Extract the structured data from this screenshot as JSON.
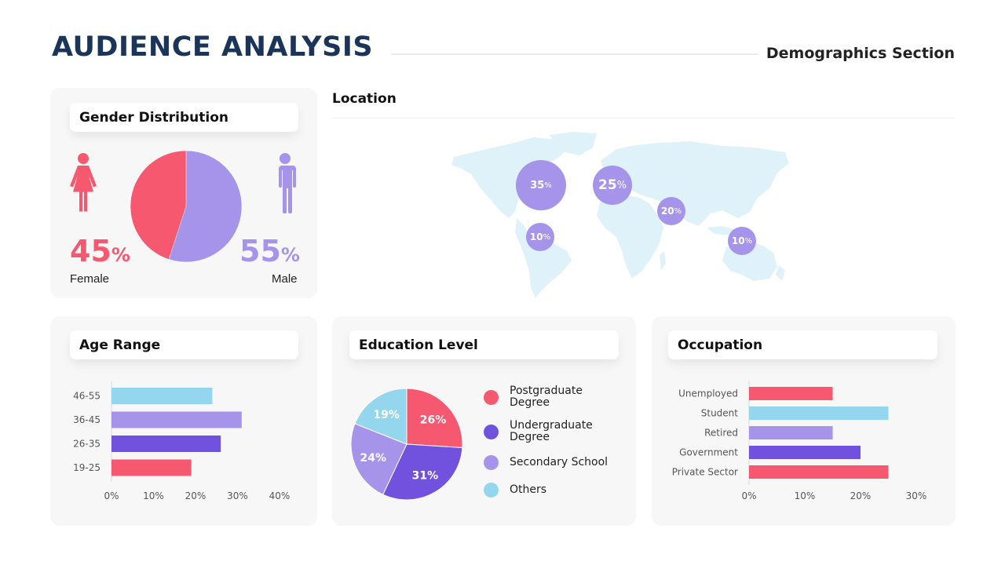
{
  "header": {
    "title": "AUDIENCE ANALYSIS",
    "section": "Demographics  Section"
  },
  "colors": {
    "navy": "#1b3459",
    "pink": "#f5586f",
    "lavender": "#a594ea",
    "purple": "#7052de",
    "sky": "#93d6ee",
    "map": "#dff1f9"
  },
  "gender": {
    "title": "Gender Distribution",
    "female": {
      "label": "Female",
      "value": "45",
      "unit": "%",
      "icon": "female-icon"
    },
    "male": {
      "label": "Male",
      "value": "55",
      "unit": "%",
      "icon": "male-icon"
    }
  },
  "location": {
    "title": "Location",
    "regions": [
      {
        "name": "North America",
        "value": "35",
        "unit": "%"
      },
      {
        "name": "Europe",
        "value": "25",
        "unit": "%"
      },
      {
        "name": "Middle East / South Asia",
        "value": "20",
        "unit": "%"
      },
      {
        "name": "South America",
        "value": "10",
        "unit": "%"
      },
      {
        "name": "Oceania / SE Asia",
        "value": "10",
        "unit": "%"
      }
    ]
  },
  "age": {
    "title": "Age Range"
  },
  "education": {
    "title": "Education Level",
    "legend": [
      {
        "line1": "Postgraduate",
        "line2": "Degree"
      },
      {
        "line1": "Undergraduate",
        "line2": "Degree"
      },
      {
        "line1": "Secondary School",
        "line2": ""
      },
      {
        "line1": "Others",
        "line2": ""
      }
    ]
  },
  "occupation": {
    "title": "Occupation"
  },
  "chart_data": [
    {
      "id": "gender",
      "type": "pie",
      "title": "Gender Distribution",
      "categories": [
        "Female",
        "Male"
      ],
      "values": [
        45,
        55
      ],
      "colors": [
        "#f5586f",
        "#a594ea"
      ]
    },
    {
      "id": "location",
      "type": "scatter",
      "title": "Location",
      "categories": [
        "North America",
        "Europe",
        "Middle East / South Asia",
        "South America",
        "Oceania / SE Asia"
      ],
      "values": [
        35,
        25,
        20,
        10,
        10
      ],
      "labels": [
        "35%",
        "25%",
        "20%",
        "10%",
        "10%"
      ]
    },
    {
      "id": "age",
      "type": "bar",
      "orientation": "horizontal",
      "title": "Age Range",
      "categories": [
        "46-55",
        "36-45",
        "26-35",
        "19-25"
      ],
      "values": [
        24,
        31,
        26,
        19
      ],
      "colors": [
        "#93d6ee",
        "#a594ea",
        "#7052de",
        "#f5586f"
      ],
      "xlim": [
        0,
        40
      ],
      "xticks": [
        "0%",
        "10%",
        "20%",
        "30%",
        "40%"
      ],
      "grid": false
    },
    {
      "id": "education",
      "type": "pie",
      "title": "Education Level",
      "categories": [
        "Postgraduate Degree",
        "Undergraduate Degree",
        "Secondary School",
        "Others"
      ],
      "values": [
        26,
        31,
        24,
        19
      ],
      "labels": [
        "26%",
        "31%",
        "24%",
        "19%"
      ],
      "colors": [
        "#f5586f",
        "#7052de",
        "#a594ea",
        "#93d6ee"
      ],
      "legend": "right"
    },
    {
      "id": "occupation",
      "type": "bar",
      "orientation": "horizontal",
      "title": "Occupation",
      "categories": [
        "Unemployed",
        "Student",
        "Retired",
        "Government",
        "Private Sector"
      ],
      "values": [
        15,
        25,
        15,
        20,
        25
      ],
      "colors": [
        "#f5586f",
        "#93d6ee",
        "#a594ea",
        "#7052de",
        "#f5586f"
      ],
      "xlim": [
        0,
        30
      ],
      "xticks": [
        "0%",
        "10%",
        "20%",
        "30%"
      ],
      "grid": false
    }
  ]
}
